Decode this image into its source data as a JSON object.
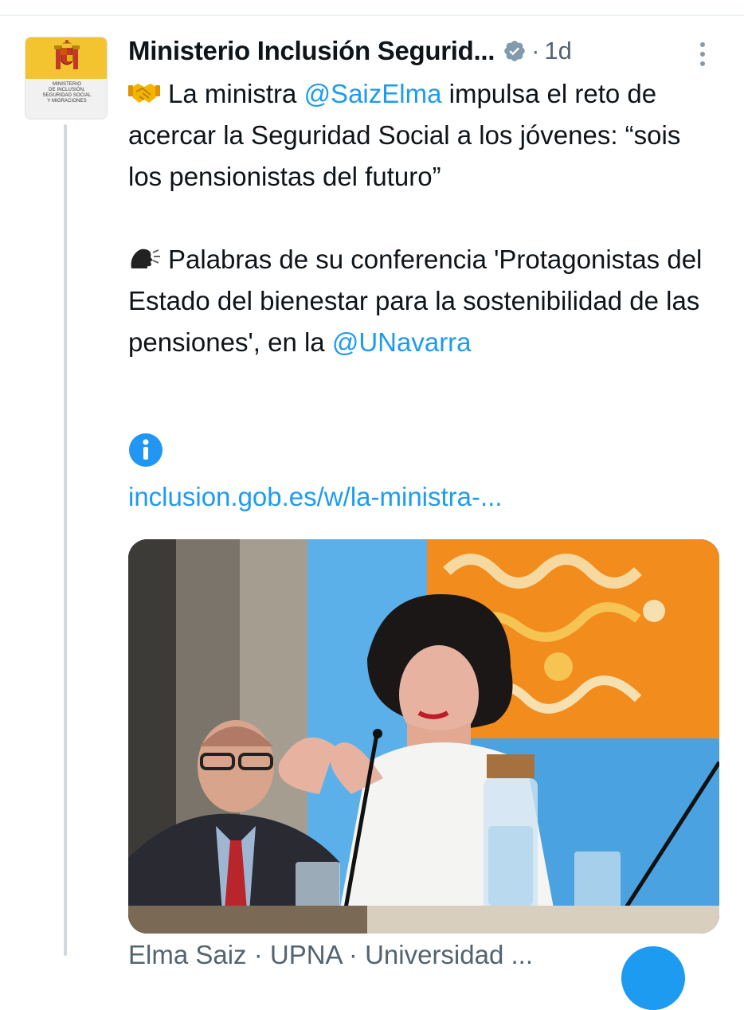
{
  "tweet": {
    "author": "Ministerio Inclusión Segurid...",
    "separator": "·",
    "time": "1d",
    "avatar_org_lines": [
      "Ministerio",
      "de Inclusión,",
      "Seguridad Social",
      "y Migraciones"
    ],
    "paragraph1_emoji": "handshake-icon",
    "paragraph1": {
      "pre": "La ministra ",
      "mention": "@SaizElma",
      "post": " impulsa el reto de acercar la Seguridad Social a los jóvenes: “sois los pensionistas del futuro”"
    },
    "paragraph2_emoji": "speaking-head-icon",
    "paragraph2": {
      "pre": "Palabras de su conferencia 'Protagonistas del Estado del bienestar para la sostenibilidad de las pensiones', en la ",
      "mention": "@UNavarra"
    },
    "info_emoji": "information-icon",
    "url": "inclusion.gob.es/w/la-ministra-...",
    "card_caption": "Elma Saiz · UPNA · Universidad ..."
  },
  "colors": {
    "link": "#1d9bf0",
    "text": "#0f1419",
    "secondary": "#536471",
    "thread_line": "#cfd9de"
  }
}
